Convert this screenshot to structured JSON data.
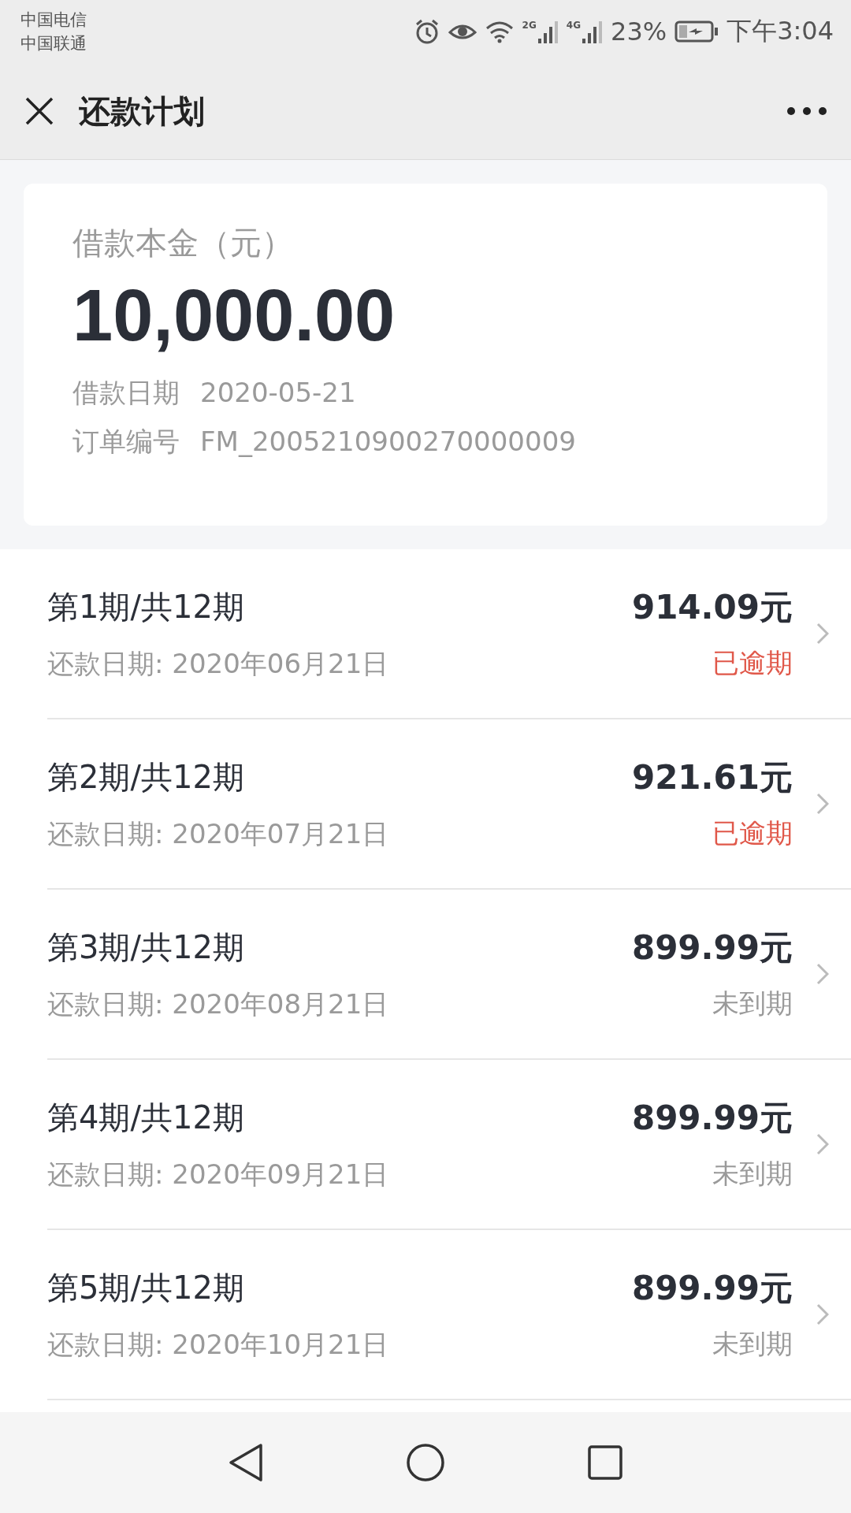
{
  "status_bar": {
    "carriers": [
      "中国电信",
      "中国联通"
    ],
    "signals": [
      {
        "label": "2G"
      },
      {
        "label": "4G"
      }
    ],
    "battery": "23%",
    "time": "下午3:04"
  },
  "header": {
    "title": "还款计划"
  },
  "loan": {
    "label": "借款本金（元）",
    "amount": "10,000.00",
    "details": [
      {
        "label": "借款日期",
        "value": "2020-05-21"
      },
      {
        "label": "订单编号",
        "value": "FM_2005210900270000009"
      }
    ]
  },
  "installments": [
    {
      "title": "第1期/共12期",
      "date": "还款日期: 2020年06月21日",
      "amount": "914.09元",
      "status": "已逾期",
      "kind": "overdue"
    },
    {
      "title": "第2期/共12期",
      "date": "还款日期: 2020年07月21日",
      "amount": "921.61元",
      "status": "已逾期",
      "kind": "overdue"
    },
    {
      "title": "第3期/共12期",
      "date": "还款日期: 2020年08月21日",
      "amount": "899.99元",
      "status": "未到期",
      "kind": "pending"
    },
    {
      "title": "第4期/共12期",
      "date": "还款日期: 2020年09月21日",
      "amount": "899.99元",
      "status": "未到期",
      "kind": "pending"
    },
    {
      "title": "第5期/共12期",
      "date": "还款日期: 2020年10月21日",
      "amount": "899.99元",
      "status": "未到期",
      "kind": "pending"
    }
  ]
}
